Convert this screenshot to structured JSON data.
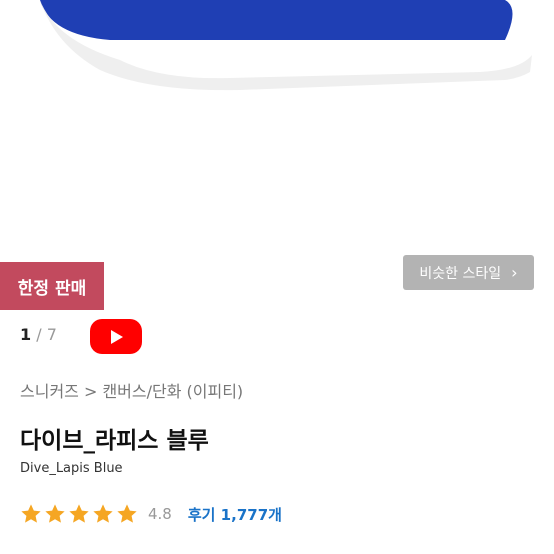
{
  "product": {
    "badge": "한정 판매",
    "similar_button_label": "비슷한 스타일",
    "similar_button_icon": "chevron-right-icon",
    "pager": {
      "current": "1",
      "separator": "/",
      "total": "7"
    },
    "video_icon": "youtube-play-icon",
    "breadcrumb": "스니커즈 > 캔버스/단화 (이피티)",
    "title": "다이브_라피스 블루",
    "subtitle": "Dive_Lapis Blue",
    "rating": {
      "stars": 5,
      "score": "4.8",
      "reviews_label": "후기 1,777개"
    }
  },
  "colors": {
    "badge": "#c24a5e",
    "star": "#f5a623",
    "link": "#1a73c8",
    "shoe_blue": "#1f3fb4",
    "youtube_red": "#ff0000"
  }
}
